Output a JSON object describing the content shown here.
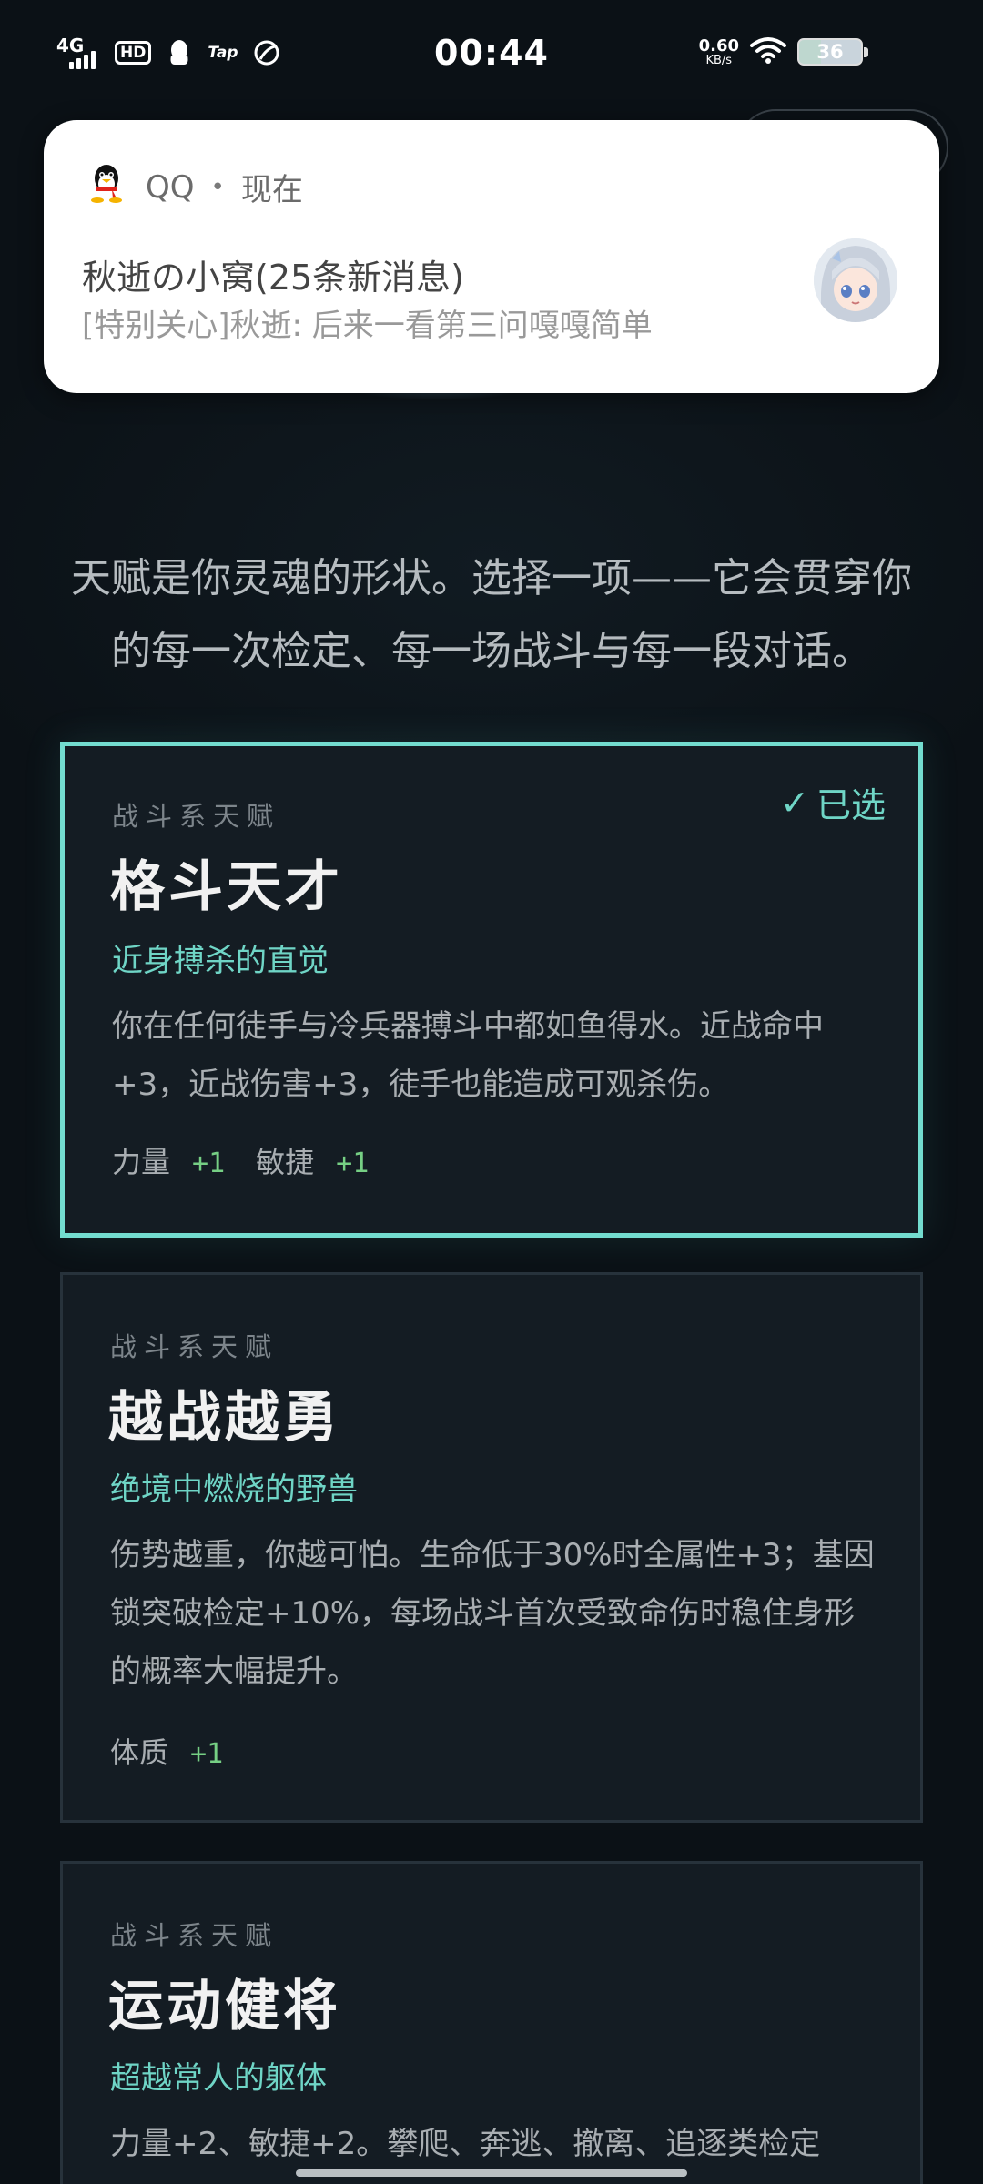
{
  "status_bar": {
    "network": "4G",
    "hd": "HD",
    "app_tap": "Tap",
    "time": "00:44",
    "speed_value": "0.60",
    "speed_unit": "KB/s",
    "battery": "36"
  },
  "notification": {
    "app": "QQ",
    "separator": "•",
    "when": "现在",
    "title": "秋逝の小窝(25条新消息)",
    "body": "[特别关心]秋逝: 后来一看第三问嘎嘎简单"
  },
  "intro": "天赋是你灵魂的形状。选择一项——它会贯穿你的每一次检定、每一场战斗与每一段对话。",
  "cards": [
    {
      "category": "战斗系天赋",
      "name": "格斗天才",
      "tagline": "近身搏杀的直觉",
      "description": "你在任何徒手与冷兵器搏斗中都如鱼得水。近战命中+3，近战伤害+3，徒手也能造成可观杀伤。",
      "badge": "已选",
      "attrs": [
        {
          "label": "力量",
          "value": "+1"
        },
        {
          "label": "敏捷",
          "value": "+1"
        }
      ]
    },
    {
      "category": "战斗系天赋",
      "name": "越战越勇",
      "tagline": "绝境中燃烧的野兽",
      "description": "伤势越重，你越可怕。生命低于30%时全属性+3；基因锁突破检定+10%，每场战斗首次受致命伤时稳住身形的概率大幅提升。",
      "attrs": [
        {
          "label": "体质",
          "value": "+1"
        }
      ]
    },
    {
      "category": "战斗系天赋",
      "name": "运动健将",
      "tagline": "超越常人的躯体",
      "description": "力量+2、敏捷+2。攀爬、奔逃、撤离、追逐类检定"
    }
  ],
  "colors": {
    "accent": "#73dccf",
    "attr_bonus": "#76cf84",
    "background": "#0b1116",
    "card": "#141c23"
  }
}
